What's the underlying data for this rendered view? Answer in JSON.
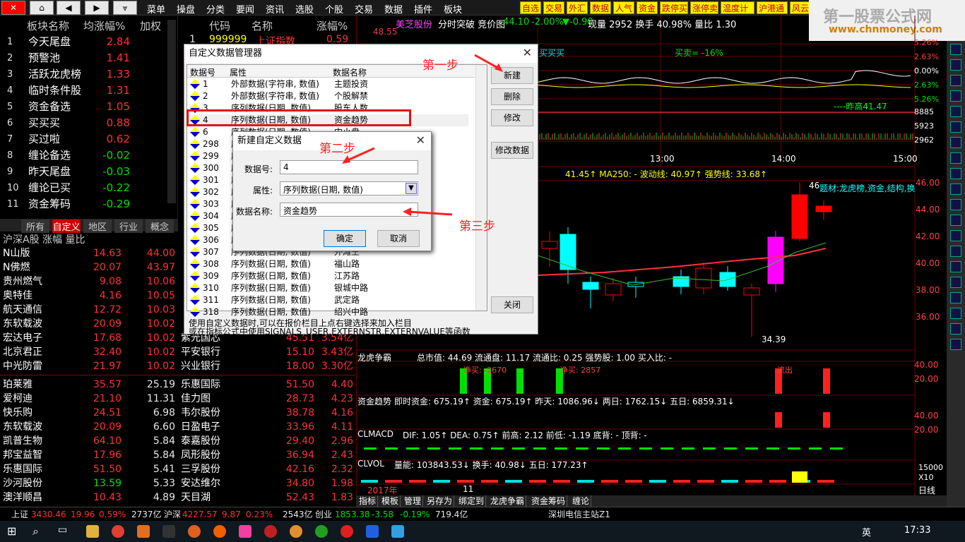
{
  "toolbar": {
    "menus": [
      "菜单",
      "操盘",
      "分类",
      "要闻",
      "资讯",
      "选股",
      "个股",
      "交易",
      "数据",
      "插件",
      "板块"
    ],
    "quick_tabs": [
      "自选",
      "交易",
      "外汇",
      "数据",
      "人气",
      "资金",
      "跌停买",
      "涨停卖",
      "温度计",
      "沪港通",
      "风云"
    ]
  },
  "watermark": {
    "title": "第一股票公式网",
    "url": "www.chnmoney.com"
  },
  "sector": {
    "headers": [
      "板块名称",
      "均涨幅%",
      "加权"
    ],
    "rows": [
      {
        "n": "1",
        "name": "今天尾盘",
        "val": "2.84",
        "c": "red"
      },
      {
        "n": "2",
        "name": "预警池",
        "val": "1.41",
        "c": "red"
      },
      {
        "n": "3",
        "name": "活跃龙虎榜",
        "val": "1.33",
        "c": "red"
      },
      {
        "n": "4",
        "name": "临时条件股",
        "val": "1.31",
        "c": "red"
      },
      {
        "n": "5",
        "name": "资金备选",
        "val": "1.05",
        "c": "red"
      },
      {
        "n": "6",
        "name": "买买买",
        "val": "0.88",
        "c": "red"
      },
      {
        "n": "7",
        "name": "买过啦",
        "val": "0.62",
        "c": "red"
      },
      {
        "n": "8",
        "name": "缠论备选",
        "val": "-0.02",
        "c": "grn"
      },
      {
        "n": "9",
        "name": "昨天尾盘",
        "val": "-0.03",
        "c": "grn"
      },
      {
        "n": "10",
        "name": "缠论已买",
        "val": "-0.22",
        "c": "grn"
      },
      {
        "n": "11",
        "name": "资金筹码",
        "val": "-0.29",
        "c": "grn"
      }
    ],
    "tabs": [
      "所有",
      "自定义",
      "地区",
      "行业",
      "概念"
    ]
  },
  "stocklist": {
    "header": "沪深A股 涨幅 量比",
    "top": [
      {
        "name": "N山版",
        "p": "14.63",
        "v": "44.00"
      },
      {
        "name": "N佛燃",
        "p": "20.07",
        "v": "43.97"
      },
      {
        "name": "贵州燃气",
        "p": "9.08",
        "v": "10.06"
      },
      {
        "name": "奥特佳",
        "p": "4.16",
        "v": "10.05"
      },
      {
        "name": "航天通信",
        "p": "12.72",
        "v": "10.03"
      },
      {
        "name": "东软载波",
        "p": "20.09",
        "v": "10.02"
      },
      {
        "name": "宏达电子",
        "p": "17.68",
        "v": "10.02"
      },
      {
        "name": "北京君正",
        "p": "32.40",
        "v": "10.02"
      },
      {
        "name": "中光防雷",
        "p": "21.97",
        "v": "10.02"
      }
    ],
    "bottom": [
      {
        "name": "珀莱雅",
        "p": "35.57",
        "v": "25.19",
        "pc": "red"
      },
      {
        "name": "爱柯迪",
        "p": "21.10",
        "v": "11.31",
        "pc": "red"
      },
      {
        "name": "快乐购",
        "p": "24.51",
        "v": "6.98",
        "pc": "red"
      },
      {
        "name": "东软载波",
        "p": "20.09",
        "v": "6.60",
        "pc": "red"
      },
      {
        "name": "凯普生物",
        "p": "64.10",
        "v": "5.84",
        "pc": "red"
      },
      {
        "name": "邦宝益智",
        "p": "17.96",
        "v": "5.84",
        "pc": "red"
      },
      {
        "name": "乐惠国际",
        "p": "51.50",
        "v": "5.41",
        "pc": "red"
      },
      {
        "name": "沙河股份",
        "p": "13.59",
        "v": "5.33",
        "pc": "grn"
      },
      {
        "name": "澳洋顺昌",
        "p": "10.43",
        "v": "4.89",
        "pc": "red"
      }
    ]
  },
  "midlist": {
    "headers": [
      "代码",
      "名称",
      "涨幅%"
    ],
    "first": {
      "n": "1",
      "code": "999999",
      "name": "上证指数",
      "val": "0.59"
    },
    "top": [
      {
        "name": "紫光国芯",
        "p": "45.51",
        "v": "3.54亿"
      },
      {
        "name": "平安银行",
        "p": "15.10",
        "v": "3.43亿"
      },
      {
        "name": "兴业银行",
        "p": "18.00",
        "v": "3.30亿"
      }
    ],
    "bottom": [
      {
        "name": "乐惠国际",
        "p": "51.50",
        "v": "4.40",
        "nc": "wht"
      },
      {
        "name": "佳力图",
        "p": "28.73",
        "v": "4.23",
        "nc": "wht"
      },
      {
        "name": "韦尔股份",
        "p": "38.78",
        "v": "4.16",
        "nc": "mag"
      },
      {
        "name": "日盈电子",
        "p": "33.96",
        "v": "4.11",
        "nc": "wht"
      },
      {
        "name": "泰嘉股份",
        "p": "29.40",
        "v": "2.96",
        "nc": "mag"
      },
      {
        "name": "凤形股份",
        "p": "36.94",
        "v": "2.43",
        "nc": "wht"
      },
      {
        "name": "三孚股份",
        "p": "42.16",
        "v": "2.32",
        "nc": "wht"
      },
      {
        "name": "安达维尔",
        "p": "34.80",
        "v": "1.98",
        "nc": "wht"
      },
      {
        "name": "天目湖",
        "p": "52.43",
        "v": "1.83",
        "nc": "wht"
      }
    ]
  },
  "chart": {
    "stock": "美芝股份",
    "info": "分时突破 竞价图",
    "price": "44.10",
    "chg": "-2.00%",
    "chg2": "▼-0.90",
    "extra": "现量 2952 换手 40.98% 量比 1.30",
    "intraday_y": [
      "5.26%",
      "2.63%",
      "0.00%",
      "2.63%",
      "5.26%"
    ],
    "intraday_vol": [
      "8885",
      "5923",
      "2962"
    ],
    "times": [
      "13:00",
      "14:00",
      "15:00"
    ],
    "left_y": [
      "48.55"
    ],
    "ma_line": "41.45↑ MA250: - 波动线: 40.97↑ 强势线: 33.68↑",
    "k_y": [
      "46.00",
      "44.00",
      "42.00",
      "40.00",
      "38.00",
      "36.00"
    ],
    "k_low": "34.39",
    "k_hi": "46",
    "k_label": "题材:龙虎榜,资金,结构,换",
    "zd": "----昨高41.47",
    "buysell": "买买买",
    "buy_pct": "买卖= -16%"
  },
  "indicators": {
    "lhzb": "龙虎争霸",
    "lhzb_info": "总市值: 44.69 流通盘: 11.17 流通比: 0.25 强势股: 1.00 买入比: -",
    "lh_small": [
      "净买: -2670",
      "净买: 2857",
      "流出"
    ],
    "zjqs": "资金趋势",
    "zjqs_info": "即时资金: 675.19↑ 资金: 675.19↑ 昨天: 1086.96↓ 两日: 1762.15↓ 五日: 6859.31↓",
    "macd": "CLMACD",
    "macd_info": "DIF: 1.05↑ DEA: 0.75↑ 前高: 2.12 前低: -1.19 底背: - 顶背: -",
    "vol": "CLVOL",
    "vol_info": "量能: 103843.53↓ 换手: 40.98↓ 五日: 177.23↑",
    "vol_y": [
      "15000",
      "X10"
    ],
    "year": "2017年",
    "month": "11",
    "period": "日线",
    "tabs": [
      "指标",
      "模板",
      "管理",
      "另存为",
      "绑定到",
      "龙虎争霸",
      "资金筹码",
      "缠论"
    ],
    "y_right": [
      "40.00",
      "20.00",
      "40.00",
      "20.00"
    ]
  },
  "dlg_main": {
    "title": "自定义数据管理器",
    "headers": [
      "数据号",
      "属性",
      "数据名称"
    ],
    "rows": [
      {
        "id": "1",
        "attr": "外部数据(字符串, 数值)",
        "name": "主题投资"
      },
      {
        "id": "2",
        "attr": "外部数据(字符串, 数值)",
        "name": "个股解禁"
      },
      {
        "id": "3",
        "attr": "序列数据(日期, 数值)",
        "name": "股东人数"
      },
      {
        "id": "4",
        "attr": "序列数据(日期, 数值)",
        "name": "资金趋势"
      },
      {
        "id": "6",
        "attr": "序列数据(日期, 数值)",
        "name": "中小盘"
      },
      {
        "id": "298",
        "attr": "序",
        "name": ""
      },
      {
        "id": "299",
        "attr": "序",
        "name": ""
      },
      {
        "id": "300",
        "attr": "序",
        "name": ""
      },
      {
        "id": "301",
        "attr": "序",
        "name": ""
      },
      {
        "id": "302",
        "attr": "序",
        "name": ""
      },
      {
        "id": "303",
        "attr": "序",
        "name": ""
      },
      {
        "id": "304",
        "attr": "序",
        "name": ""
      },
      {
        "id": "305",
        "attr": "序",
        "name": ""
      },
      {
        "id": "306",
        "attr": "序",
        "name": ""
      },
      {
        "id": "307",
        "attr": "序列数据(日期, 数值)",
        "name": "外滩王"
      },
      {
        "id": "308",
        "attr": "序列数据(日期, 数值)",
        "name": "福山路"
      },
      {
        "id": "309",
        "attr": "序列数据(日期, 数值)",
        "name": "江苏路"
      },
      {
        "id": "310",
        "attr": "序列数据(日期, 数值)",
        "name": "银城中路"
      },
      {
        "id": "311",
        "attr": "序列数据(日期, 数值)",
        "name": "武定路"
      },
      {
        "id": "318",
        "attr": "序列数据(日期, 数值)",
        "name": "绍兴中路"
      }
    ],
    "buttons": {
      "new": "新建",
      "delete": "删除",
      "modify": "修改",
      "modify_data": "修改数据",
      "close": "关闭"
    },
    "note1": "使用自定义数据时,可以在报价栏目上点右键选择来加入栏目",
    "note2": "或在指标公式中使用SIGNALS_USER,EXTERNSTR,EXTERNVALUE等函数"
  },
  "dlg_new": {
    "title": "新建自定义数据",
    "id_label": "数据号:",
    "id_value": "4",
    "attr_label": "属性:",
    "attr_value": "序列数据(日期, 数值)",
    "name_label": "数据名称:",
    "name_value": "资金趋势",
    "ok": "确定",
    "cancel": "取消"
  },
  "annotations": {
    "step1": "第一步",
    "step2": "第二步",
    "step3": "第三步"
  },
  "statusbar": {
    "sh": "上证",
    "sh_v": "3430.46",
    "sh_c": "19.96",
    "sh_p": "0.59%",
    "sh_a": "2737亿",
    "hs": "沪深",
    "hs_v": "4227.57",
    "hs_c": "9.87",
    "hs_p": "0.23%",
    "hs_a": "2543亿",
    "cy": "创业",
    "cy_v": "1853.38",
    "cy_c": "-3.58",
    "cy_p": "-0.19%",
    "cy_a": "719.4亿",
    "site": "深圳电信主站Z1"
  },
  "taskbar": {
    "time": "17:33",
    "ime": "英"
  }
}
